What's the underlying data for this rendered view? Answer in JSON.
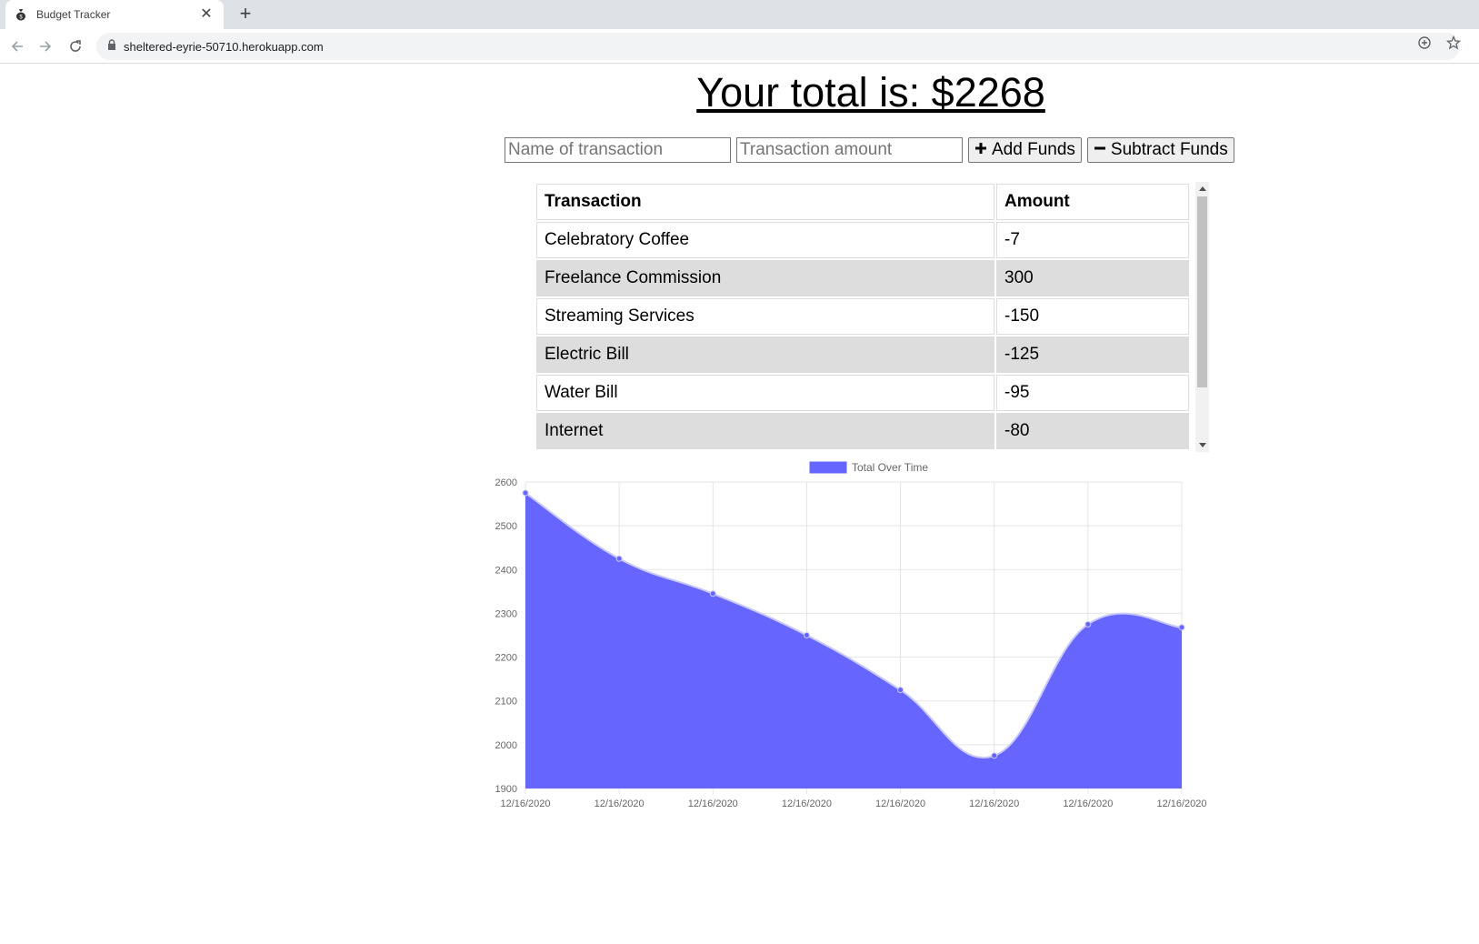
{
  "browser": {
    "tab_title": "Budget Tracker",
    "url": "sheltered-eyrie-50710.herokuapp.com",
    "new_tab_symbol": "+",
    "close_symbol": "✕"
  },
  "page": {
    "total_text": "Your total is: $2268",
    "name_placeholder": "Name of transaction",
    "amount_placeholder": "Transaction amount",
    "add_label": "Add Funds",
    "subtract_label": "Subtract Funds",
    "add_icon": "plus-icon",
    "subtract_icon": "minus-icon"
  },
  "table": {
    "headers": [
      "Transaction",
      "Amount"
    ],
    "rows": [
      {
        "name": "Celebratory Coffee",
        "amount": "-7"
      },
      {
        "name": "Freelance Commission",
        "amount": "300"
      },
      {
        "name": "Streaming Services",
        "amount": "-150"
      },
      {
        "name": "Electric Bill",
        "amount": "-125"
      },
      {
        "name": "Water Bill",
        "amount": "-95"
      },
      {
        "name": "Internet",
        "amount": "-80"
      }
    ]
  },
  "chart_data": {
    "type": "area",
    "legend": "Total Over Time",
    "legend_position": "top",
    "color": "#6666ff",
    "x": [
      "12/16/2020",
      "12/16/2020",
      "12/16/2020",
      "12/16/2020",
      "12/16/2020",
      "12/16/2020",
      "12/16/2020",
      "12/16/2020"
    ],
    "series": [
      {
        "name": "Total Over Time",
        "values": [
          2575,
          2425,
          2345,
          2250,
          2125,
          1975,
          2275,
          2268
        ]
      }
    ],
    "ylim": [
      1900,
      2600
    ],
    "yticks": [
      1900,
      2000,
      2100,
      2200,
      2300,
      2400,
      2500,
      2600
    ],
    "grid": true
  }
}
